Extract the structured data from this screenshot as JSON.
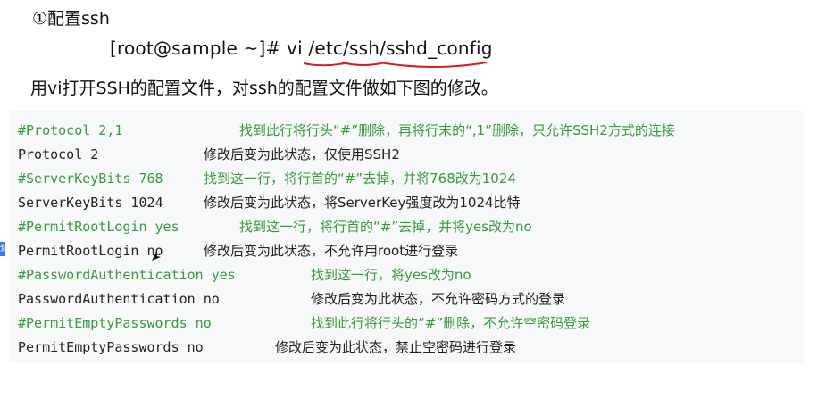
{
  "heading": "①配置ssh",
  "command": "[root@sample ~]# vi /etc/ssh/sshd_config",
  "description": "用vi打开SSH的配置文件，对ssh的配置文件做如下图的修改。",
  "side_tab": "划",
  "lines": [
    {
      "code": "#Protocol 2,1",
      "note": "找到此行将行头“#”删除，再将行末的“,1”删除，只允许SSH2方式的连接"
    },
    {
      "code": "Protocol 2",
      "note": "修改后变为此状态，仅使用SSH2"
    },
    {
      "code": "#ServerKeyBits 768",
      "note": "找到这一行，将行首的“#”去掉，并将768改为1024"
    },
    {
      "code": "ServerKeyBits 1024",
      "note": "修改后变为此状态，将ServerKey强度改为1024比特"
    },
    {
      "code": "#PermitRootLogin yes",
      "note": "找到这一行，将行首的“#”去掉，并将yes改为no"
    },
    {
      "code": "PermitRootLogin no",
      "note": "修改后变为此状态，不允许用root进行登录"
    },
    {
      "code": "#PasswordAuthentication yes",
      "note": "找到这一行，将yes改为no"
    },
    {
      "code": "PasswordAuthentication no",
      "note": "修改后变为此状态，不允许密码方式的登录"
    },
    {
      "code": "#PermitEmptyPasswords no",
      "note": "找到此行将行头的“#”删除，不允许空密码登录"
    },
    {
      "code": "PermitEmptyPasswords no",
      "note": "修改后变为此状态，禁止空密码进行登录"
    }
  ],
  "colors": {
    "comment": "#3a9a3a",
    "plain": "#222222",
    "code_background": "#f6f8fa",
    "annotation_red": "#d62020"
  }
}
